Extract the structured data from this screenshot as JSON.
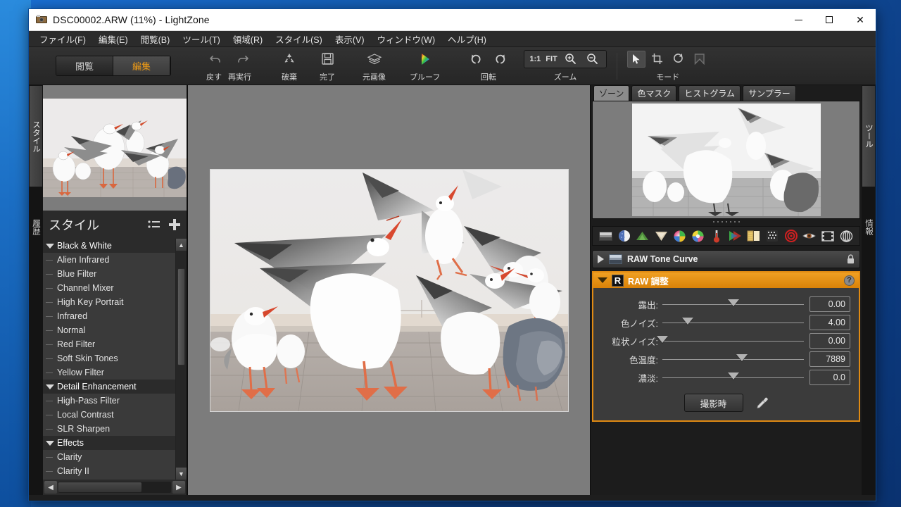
{
  "window": {
    "title": "DSC00002.ARW (11%) - LightZone",
    "icon": "camera-icon",
    "controls": {
      "minimize": "–",
      "maximize": "☐",
      "close": "✕"
    }
  },
  "menubar": {
    "items": [
      {
        "label": "ファイル(F)",
        "mnemonic": "F"
      },
      {
        "label": "編集(E)",
        "mnemonic": "E"
      },
      {
        "label": "閲覧(B)",
        "mnemonic": "B"
      },
      {
        "label": "ツール(T)",
        "mnemonic": "T"
      },
      {
        "label": "領域(R)",
        "mnemonic": "R"
      },
      {
        "label": "スタイル(S)",
        "mnemonic": "S"
      },
      {
        "label": "表示(V)",
        "mnemonic": "V"
      },
      {
        "label": "ウィンドウ(W)",
        "mnemonic": "W"
      },
      {
        "label": "ヘルプ(H)",
        "mnemonic": "H"
      }
    ]
  },
  "toolbar": {
    "mode_browse": "閲覧",
    "mode_edit": "編集",
    "undo_redo_label": "戻す 再実行",
    "undo_label": "戻す",
    "redo_label": "再実行",
    "discard_label": "破棄",
    "done_label": "完了",
    "original_label": "元画像",
    "proof_label": "プルーフ",
    "rotate_label": "回転",
    "zoom_label": "ズーム",
    "zoom_one_to_one": "1:1",
    "zoom_fit": "FIT",
    "mode_label": "モード"
  },
  "left_rail": {
    "tab_styles": "スタイル",
    "tab_history": "履歴"
  },
  "right_rail": {
    "tab_tools": "ツール",
    "tab_info": "情報"
  },
  "styles_panel": {
    "title": "スタイル",
    "items": [
      {
        "label": "Black & White",
        "type": "group"
      },
      {
        "label": "Alien Infrared",
        "type": "child"
      },
      {
        "label": "Blue Filter",
        "type": "child"
      },
      {
        "label": "Channel Mixer",
        "type": "child"
      },
      {
        "label": "High Key Portrait",
        "type": "child"
      },
      {
        "label": "Infrared",
        "type": "child"
      },
      {
        "label": "Normal",
        "type": "child"
      },
      {
        "label": "Red Filter",
        "type": "child"
      },
      {
        "label": "Soft Skin Tones",
        "type": "child"
      },
      {
        "label": "Yellow Filter",
        "type": "child"
      },
      {
        "label": "Detail Enhancement",
        "type": "group"
      },
      {
        "label": "High-Pass Filter",
        "type": "child"
      },
      {
        "label": "Local Contrast",
        "type": "child"
      },
      {
        "label": "SLR Sharpen",
        "type": "child"
      },
      {
        "label": "Effects",
        "type": "group"
      },
      {
        "label": "Clarity",
        "type": "child"
      },
      {
        "label": "Clarity II",
        "type": "child"
      }
    ]
  },
  "right_panel": {
    "tabs": [
      {
        "label": "ゾーン",
        "active": true
      },
      {
        "label": "色マスク",
        "active": false
      },
      {
        "label": "ヒストグラム",
        "active": false
      },
      {
        "label": "サンプラー",
        "active": false
      }
    ],
    "tool_icons": [
      "zone-mapper-icon",
      "relight-icon",
      "sharpen-icon",
      "blur-icon",
      "hue-saturation-icon",
      "color-balance-icon",
      "white-balance-icon",
      "channel-mixer-icon",
      "black-and-white-icon",
      "noise-reduction-icon",
      "red-eye-icon",
      "clone-icon",
      "spot-icon",
      "gaussian-icon"
    ],
    "tool_rows": [
      {
        "name": "RAW Tone Curve",
        "expanded": false,
        "locked": true,
        "icon": "tone-curve-icon"
      }
    ],
    "raw_adjust": {
      "title": "RAW 調整",
      "badge": "R",
      "help": "?",
      "expanded": true,
      "sliders": [
        {
          "label": "露出:",
          "value": "0.00",
          "pos": 50
        },
        {
          "label": "色ノイズ:",
          "value": "4.00",
          "pos": 18
        },
        {
          "label": "粒状ノイズ:",
          "value": "0.00",
          "pos": 0
        },
        {
          "label": "色温度:",
          "value": "7889",
          "pos": 56
        },
        {
          "label": "濃淡:",
          "value": "0.0",
          "pos": 50
        }
      ],
      "button_label": "撮影時",
      "picker_icon": "eyedropper-icon"
    }
  },
  "colors": {
    "accent": "#e08a12",
    "titlebar_bg": "#ffffff",
    "window_bg": "#2b2b2b",
    "canvas_bg": "#7c7c7c",
    "desktop_blue": "#1257a8"
  }
}
